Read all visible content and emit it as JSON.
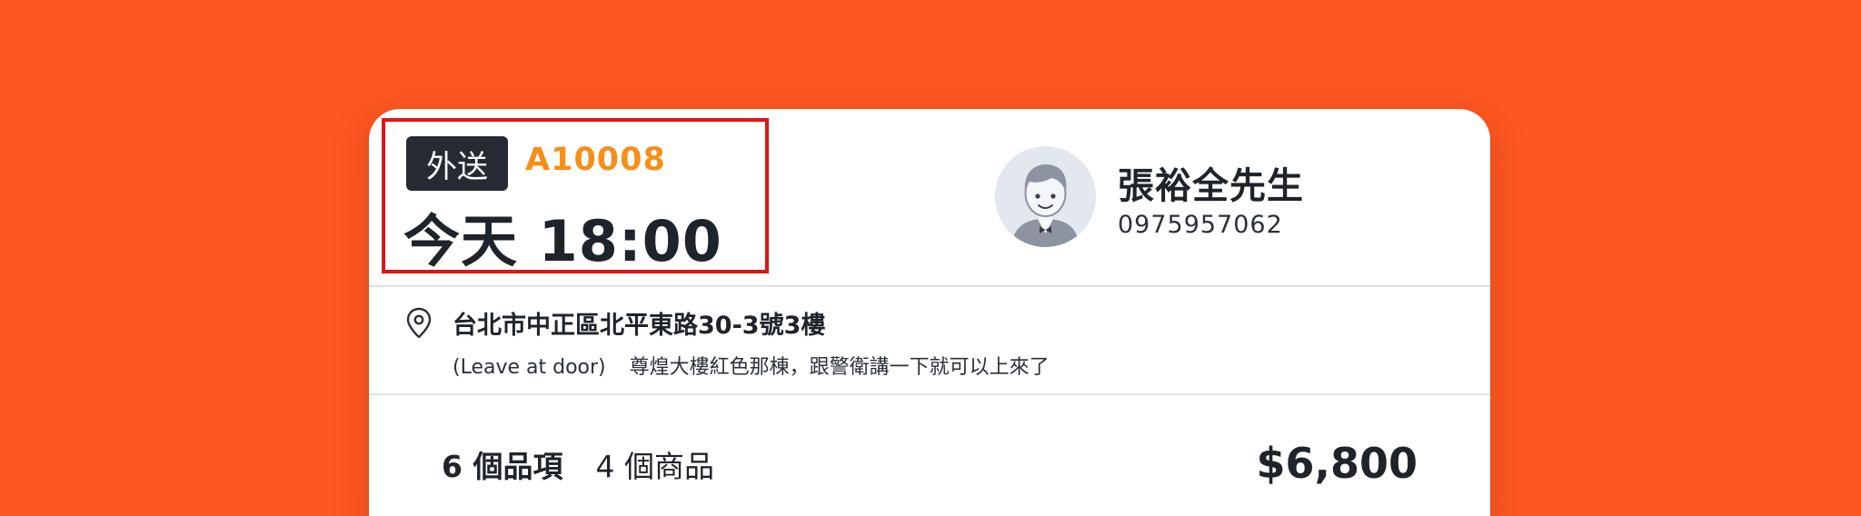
{
  "order": {
    "type_label": "外送",
    "id": "A10008",
    "pickup_time": "今天 18:00"
  },
  "customer": {
    "name": "張裕全先生",
    "phone": "0975957062"
  },
  "address": {
    "line": "台北市中正區北平東路30-3號3樓",
    "instruction": "(Leave at door)",
    "note": "尊煌大樓紅色那棟，跟警衛講一下就可以上來了"
  },
  "summary": {
    "items_count": "6 個品項",
    "products_count": "4 個商品",
    "total": "$6,800"
  },
  "icons": {
    "location": "map-pin-icon",
    "avatar": "customer-avatar"
  },
  "colors": {
    "background": "#fe5722",
    "order_id": "#f49019",
    "badge": "#262b33",
    "highlight_frame": "#e01414"
  }
}
